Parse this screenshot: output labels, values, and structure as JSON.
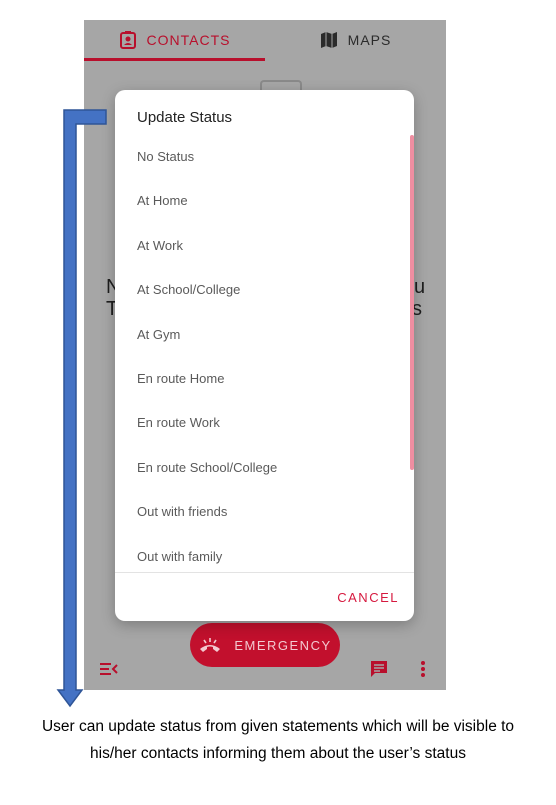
{
  "tabs": {
    "contacts": "CONTACTS",
    "maps": "MAPS"
  },
  "background_text": {
    "line1_left": "N",
    "line2_left": "T",
    "line1_right": "u",
    "line2_right": "s"
  },
  "dialog": {
    "title": "Update Status",
    "options": [
      "No Status",
      "At Home",
      "At Work",
      "At School/College",
      "At Gym",
      "En route Home",
      "En route Work",
      "En route School/College",
      "Out with friends",
      "Out with family"
    ],
    "cancel": "CANCEL"
  },
  "emergency_label": "EMERGENCY",
  "caption": "User can update status from given statements which will be visible to his/her contacts informing them about the user’s status",
  "colors": {
    "accent": "#b80f2c",
    "annotation_arrow": "#4472c4"
  },
  "icons": [
    "contacts-icon",
    "map-icon",
    "phone-icon",
    "menu-collapse-icon",
    "chat-icon",
    "more-vert-icon"
  ]
}
